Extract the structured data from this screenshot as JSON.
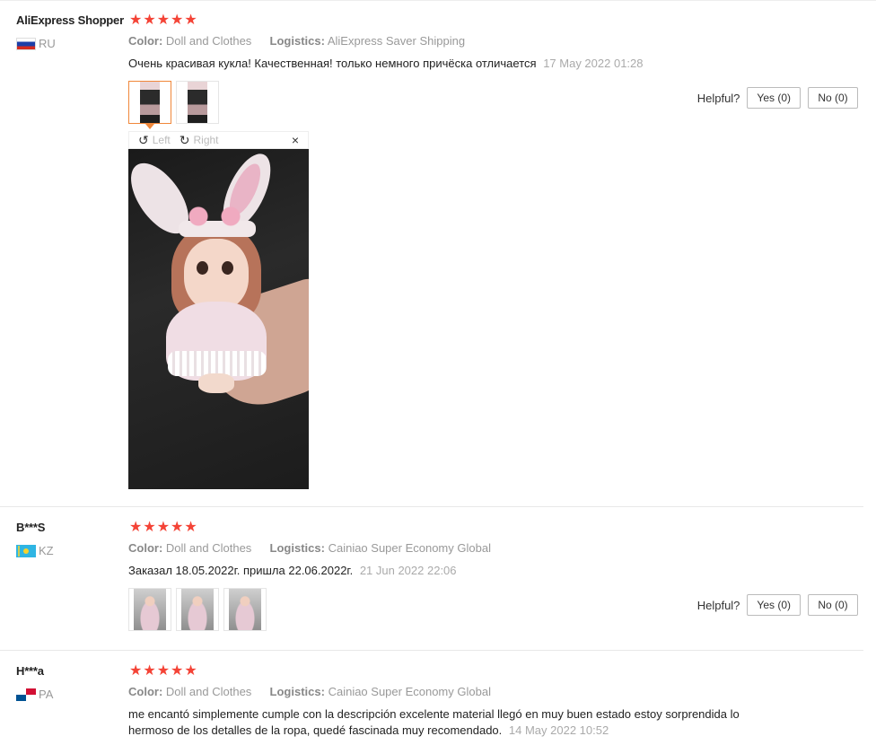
{
  "reviews": [
    {
      "user": "AliExpress Shopper",
      "country": "RU",
      "stars": [
        "★",
        "★",
        "★",
        "★",
        "★"
      ],
      "color_label": "Color:",
      "color_value": "Doll and Clothes",
      "logistics_label": "Logistics:",
      "logistics_value": "AliExpress Saver Shipping",
      "text": "Очень красивая кукла! Качественная! только немного причёска отличается",
      "date": "17 May 2022 01:28",
      "helpful_label": "Helpful?",
      "yes_label": "Yes (0)",
      "no_label": "No (0)"
    },
    {
      "user": "B***S",
      "country": "KZ",
      "stars": [
        "★",
        "★",
        "★",
        "★",
        "★"
      ],
      "color_label": "Color:",
      "color_value": "Doll and Clothes",
      "logistics_label": "Logistics:",
      "logistics_value": "Cainiao Super Economy Global",
      "text": "Заказал 18.05.2022г. пришла 22.06.2022г.",
      "date": "21 Jun 2022 22:06",
      "helpful_label": "Helpful?",
      "yes_label": "Yes (0)",
      "no_label": "No (0)"
    },
    {
      "user": "H***a",
      "country": "PA",
      "stars": [
        "★",
        "★",
        "★",
        "★",
        "★"
      ],
      "color_label": "Color:",
      "color_value": "Doll and Clothes",
      "logistics_label": "Logistics:",
      "logistics_value": "Cainiao Super Economy Global",
      "text_line1": "me encantó simplemente cumple con la descripción excelente material llegó en muy buen estado estoy sorprendida lo",
      "text_line2": "hermoso de los detalles de la ropa, quedé fascinada muy recomendado.",
      "date": "14 May 2022 10:52"
    }
  ],
  "viewer": {
    "rotate_left_label": "Left",
    "rotate_right_label": "Right",
    "close_glyph": "×",
    "rotate_left_glyph": "↺",
    "rotate_right_glyph": "↻"
  },
  "colors": {
    "star": "#f44336",
    "active_thumb_border": "#f0873a",
    "meta_text": "#999999"
  }
}
